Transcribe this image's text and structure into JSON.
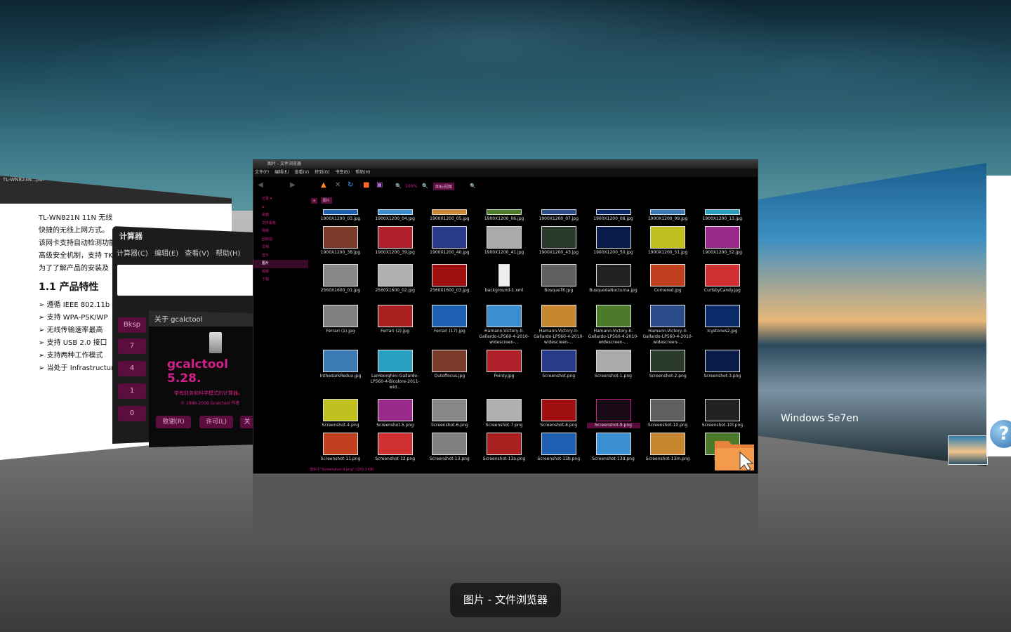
{
  "switcher_label": "图片 - 文件浏览器",
  "pdf": {
    "title": "TL-WN823N...pdf",
    "intro": "TL-WN821N 11N 无线",
    "lines": [
      "快捷的无线上网方式。",
      "该网卡支持自动检测功能",
      "高级安全机制，支持 TK",
      "为了了解产品的安装及"
    ],
    "section": "1.1   产品特性",
    "bullets": [
      "遵循 IEEE 802.11b",
      "支持 WPA-PSK/WP",
      "无线传输速率最高",
      "支持 USB 2.0 接口",
      "支持两种工作模式",
      "当处于 Infrastructur"
    ]
  },
  "calculator": {
    "title": "计算器",
    "menu": [
      "计算器(C)",
      "编辑(E)",
      "查看(V)",
      "帮助(H)"
    ],
    "keys": [
      "Bksp",
      "7",
      "4",
      "1",
      "0"
    ]
  },
  "about": {
    "title": "关于 gcalctool",
    "name": "gcalctool 5.28.",
    "desc": "带有财务和科学模式的计算器。",
    "copyright": "© 1986-2008 Gcalctool 作者",
    "buttons": [
      "致谢(R)",
      "许可(L)",
      "关"
    ]
  },
  "win7": {
    "logo": "Windows Se7en"
  },
  "help_icon": "?",
  "file_browser": {
    "title": "图片 - 文件浏览器",
    "menu": [
      "文件(F)",
      "编辑(E)",
      "查看(V)",
      "转到(G)",
      "书签(B)",
      "帮助(H)"
    ],
    "zoom": "100%",
    "view_mode": "图标视图",
    "side_header": "位置 ▾",
    "places": [
      "a",
      "桌面",
      "文件系统",
      "网络",
      "回收站",
      "文档",
      "音乐",
      "图片",
      "视频",
      "下载"
    ],
    "path": [
      "a",
      "图片"
    ],
    "status": "选中了\"Screenshot-9.png\" (150.3 KB)",
    "files": [
      [
        "1900X1200_03.jpg",
        "1900X1200_04.jpg",
        "1900X1200_05.jpg",
        "1900X1200_06.jpg",
        "1900X1200_07.jpg",
        "1900X1200_08.jpg",
        "1900X1200_09.jpg",
        "1900X1200_13.jpg"
      ],
      [
        "1900X1200_38.jpg",
        "1900X1200_39.jpg",
        "1900X1200_40.jpg",
        "1900X1200_41.jpg",
        "1900X1200_43.jpg",
        "1900X1200_50.jpg",
        "1900X1200_51.jpg",
        "1900X1200_52.jpg"
      ],
      [
        "2560X1600_01.jpg",
        "2560X1600_02.jpg",
        "2560X1600_03.jpg",
        "background-1.xml",
        "BosqueTK.jpg",
        "BusquedaNocturna.jpg",
        "Cornered.jpg",
        "CurlsbyCandy.jpg"
      ],
      [
        "Ferrari (1).jpg",
        "Ferrari (2).jpg",
        "Ferrari (17).jpg",
        "Hamann-Victory-II-Gallardo-LP560-4-2010-widescreen-...",
        "Hamann-Victory-II-Gallardo-LP560-4-2010-widescreen-...",
        "Hamann-Victory-II-Gallardo-LP560-4-2010-widescreen-...",
        "Hamann-Victory-II-Gallardo-LP560-4-2010-widescreen-...",
        "Icystones2.jpg"
      ],
      [
        "InthedarkRedux.jpg",
        "Lamborghini-Gallardo-LP560-4-Bicolore-2011-wid...",
        "Outoffocus.jpg",
        "Pointy.jpg",
        "Screenshot.png",
        "Screenshot-1.png",
        "Screenshot-2.png",
        "Screenshot-3.png"
      ],
      [
        "Screenshot-4.png",
        "Screenshot-5.png",
        "Screenshot-6.png",
        "Screenshot-7.png",
        "Screenshot-8.png",
        "Screenshot-9.png",
        "Screenshot-10.png",
        "Screenshot-10l.png"
      ],
      [
        "Screenshot-11.png",
        "Screenshot-12.png",
        "Screenshot-13.png",
        "Screenshot-13a.png",
        "Screenshot-13b.png",
        "Screenshot-13d.png",
        "Screenshot-13m.png",
        "Screens"
      ]
    ]
  },
  "colors": {
    "accent": "#d2208b",
    "button": "#5b0d3e"
  }
}
